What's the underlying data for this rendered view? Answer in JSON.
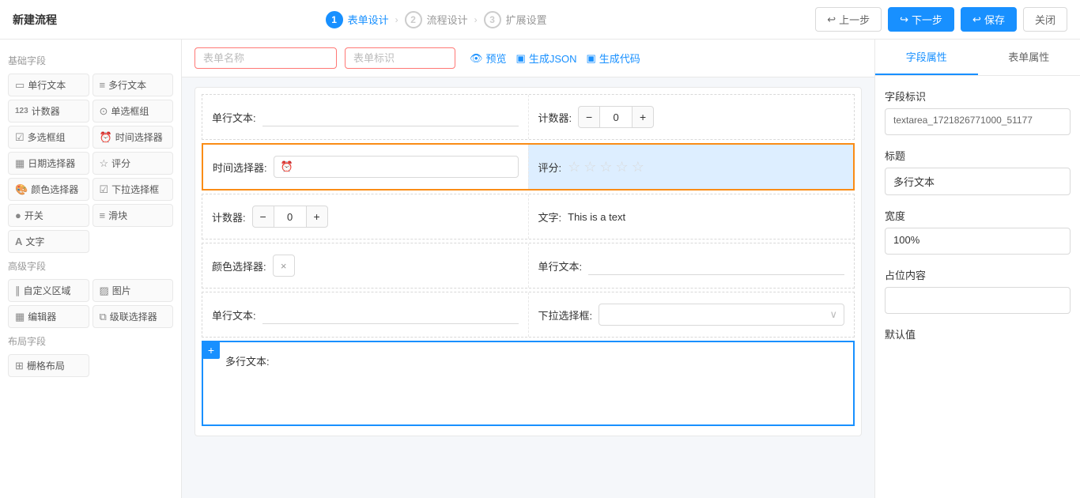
{
  "header": {
    "title": "新建流程",
    "steps": [
      {
        "num": "1",
        "label": "表单设计",
        "active": true
      },
      {
        "num": "2",
        "label": "流程设计",
        "active": false
      },
      {
        "num": "3",
        "label": "扩展设置",
        "active": false
      }
    ],
    "btn_prev": "上一步",
    "btn_next": "下一步",
    "btn_save": "保存",
    "btn_close": "关闭"
  },
  "sidebar": {
    "basic_title": "基础字段",
    "basic_items": [
      {
        "id": "single-text",
        "icon": "▭",
        "label": "单行文本"
      },
      {
        "id": "multi-text",
        "icon": "≡",
        "label": "多行文本"
      },
      {
        "id": "counter",
        "icon": "123",
        "label": "计数器"
      },
      {
        "id": "radio-group",
        "icon": "⊙",
        "label": "单选框组"
      },
      {
        "id": "checkbox-group",
        "icon": "☑",
        "label": "多选框组"
      },
      {
        "id": "time-picker",
        "icon": "⏰",
        "label": "时间选择器"
      },
      {
        "id": "date-picker",
        "icon": "▦",
        "label": "日期选择器"
      },
      {
        "id": "rating",
        "icon": "☆",
        "label": "评分"
      },
      {
        "id": "color-picker",
        "icon": "🎨",
        "label": "颜色选择器"
      },
      {
        "id": "dropdown",
        "icon": "☑",
        "label": "下拉选择框"
      },
      {
        "id": "switch",
        "icon": "●",
        "label": "开关"
      },
      {
        "id": "slider",
        "icon": "≡",
        "label": "滑块"
      },
      {
        "id": "text",
        "icon": "A",
        "label": "文字"
      }
    ],
    "advanced_title": "高级字段",
    "advanced_items": [
      {
        "id": "custom-area",
        "icon": "∥",
        "label": "自定义区域"
      },
      {
        "id": "image",
        "icon": "▨",
        "label": "图片"
      },
      {
        "id": "editor",
        "icon": "▦",
        "label": "编辑器"
      },
      {
        "id": "cascade",
        "icon": "⧉",
        "label": "级联选择器"
      }
    ],
    "layout_title": "布局字段",
    "layout_items": [
      {
        "id": "grid",
        "icon": "⊞",
        "label": "栅格布局"
      }
    ]
  },
  "toolbar": {
    "placeholder_name": "表单名称",
    "placeholder_mark": "表单标识",
    "preview": "预览",
    "gen_json": "生成JSON",
    "gen_code": "生成代码"
  },
  "canvas": {
    "rows": [
      {
        "id": "row1",
        "cells": [
          {
            "label": "单行文本:",
            "type": "input",
            "value": ""
          },
          {
            "label": "计数器:",
            "type": "counter",
            "value": "0"
          }
        ]
      },
      {
        "id": "row2",
        "selected": true,
        "orange": true,
        "cells": [
          {
            "label": "时间选择器:",
            "type": "timepicker",
            "value": ""
          },
          {
            "label": "评分:",
            "type": "rating",
            "stars": 5
          }
        ]
      },
      {
        "id": "row3",
        "cells": [
          {
            "label": "计数器:",
            "type": "counter",
            "value": "0"
          },
          {
            "label": "文字:",
            "type": "text",
            "value": "This is a text"
          }
        ]
      },
      {
        "id": "row4",
        "cells": [
          {
            "label": "颜色选择器:",
            "type": "colorpicker"
          },
          {
            "label": "单行文本:",
            "type": "input",
            "value": ""
          }
        ]
      },
      {
        "id": "row5",
        "cells": [
          {
            "label": "单行文本:",
            "type": "input",
            "value": ""
          },
          {
            "label": "下拉选择框:",
            "type": "select"
          }
        ]
      }
    ],
    "multitext_row": {
      "label": "多行文本:",
      "type": "textarea"
    }
  },
  "right_panel": {
    "tab_field": "字段属性",
    "tab_form": "表单属性",
    "field_id_label": "字段标识",
    "field_id_value": "textarea_1721826771000_51177",
    "title_label": "标题",
    "title_value": "多行文本",
    "width_label": "宽度",
    "width_value": "100%",
    "placeholder_label": "占位内容",
    "placeholder_value": "",
    "default_label": "默认值"
  }
}
